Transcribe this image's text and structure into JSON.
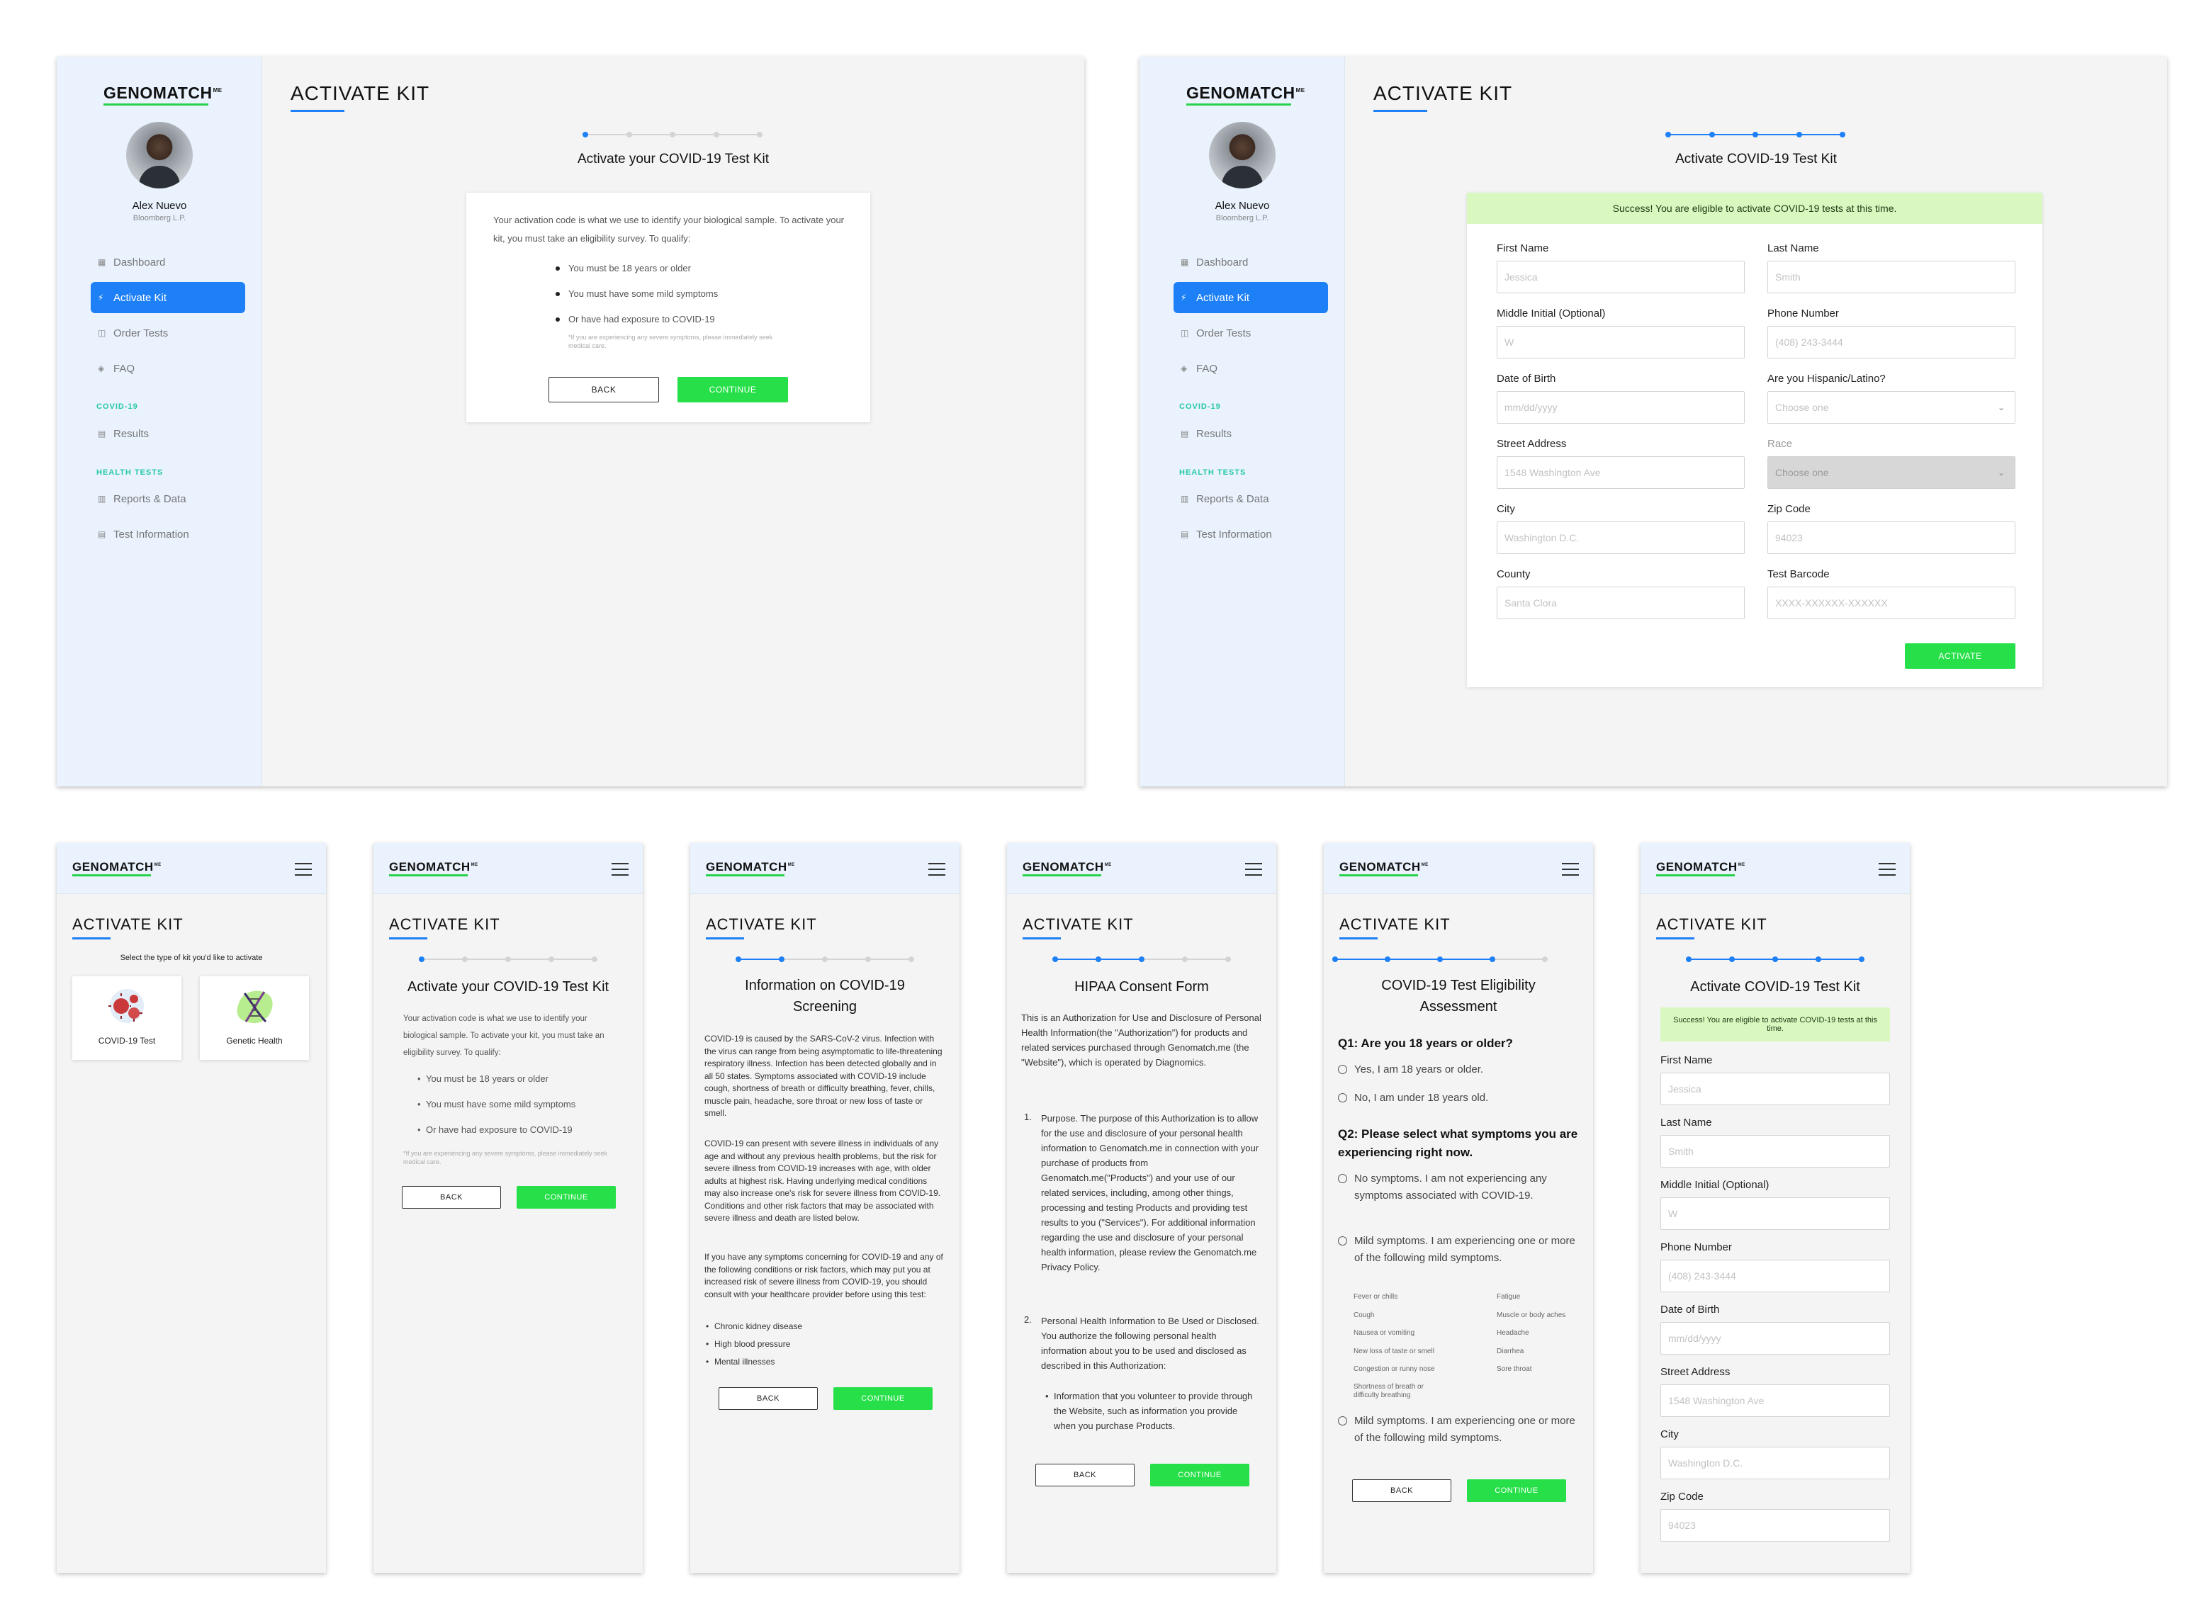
{
  "common": {
    "logo": "GENOMATCH",
    "logo_sup": "ME",
    "page_title": "ACTIVATE KIT",
    "back": "BACK",
    "continue": "CONTINUE"
  },
  "user": {
    "name": "Alex Nuevo",
    "company": "Bloomberg L.P."
  },
  "sidebar": {
    "items": [
      {
        "label": "Dashboard",
        "icon": "dashboard-icon",
        "glyph": "▦"
      },
      {
        "label": "Activate Kit",
        "icon": "lightning-icon",
        "glyph": "⚡"
      },
      {
        "label": "Order Tests",
        "icon": "bag-icon",
        "glyph": "◫"
      },
      {
        "label": "FAQ",
        "icon": "tag-icon",
        "glyph": "◈"
      }
    ],
    "section_covid": "COVID-19",
    "results": "Results",
    "section_health": "HEALTH TESTS",
    "reports": "Reports & Data",
    "test_info": "Test Information"
  },
  "colors": {
    "accent": "#1e80f6",
    "green": "#27e049",
    "sidebar": "#e9f2fd",
    "section": "#27c9a7",
    "success": "#d8f8c0"
  },
  "intro": {
    "heading": "Activate your COVID-19 Test Kit",
    "text": "Your activation code is what we use to identify your biological sample. To activate your kit, you must take an eligibility survey. To qualify:",
    "bullets": [
      "You must be 18 years or older",
      "You must have some mild symptoms",
      "Or have had exposure to COVID-19"
    ],
    "note": "*If you are experiencing any severe symptoms, please immediately seek medical care."
  },
  "form": {
    "heading": "Activate COVID-19 Test Kit",
    "success": "Success! You are eligible to activate COVID-19 tests at this time.",
    "activate": "ACTIVATE",
    "first_name": {
      "label": "First Name",
      "placeholder": "Jessica"
    },
    "last_name": {
      "label": "Last Name",
      "placeholder": "Smith"
    },
    "middle": {
      "label": "Middle Initial (Optional)",
      "placeholder": "W"
    },
    "phone": {
      "label": "Phone Number",
      "placeholder": "(408) 243-3444"
    },
    "dob": {
      "label": "Date of Birth",
      "placeholder": "mm/dd/yyyy"
    },
    "hispanic": {
      "label": "Are you Hispanic/Latino?",
      "placeholder": "Choose one"
    },
    "street": {
      "label": "Street Address",
      "placeholder": "1548 Washington Ave"
    },
    "race": {
      "label": "Race",
      "placeholder": "Choose one"
    },
    "city": {
      "label": "City",
      "placeholder": "Washington D.C."
    },
    "zip": {
      "label": "Zip Code",
      "placeholder": "94023"
    },
    "county": {
      "label": "County",
      "placeholder": "Santa Clora"
    },
    "barcode": {
      "label": "Test Barcode",
      "placeholder": "XXXX-XXXXXX-XXXXXX"
    }
  },
  "select_kit": {
    "prompt": "Select the type of kit you'd like to activate",
    "covid": "COVID-19 Test",
    "genetic": "Genetic Health"
  },
  "info": {
    "heading": "Information on COVID-19 Screening",
    "p1": "COVID-19 is caused by the SARS-CoV-2 virus. Infection with the virus can range from being asymptomatic to life-threatening respiratory illness. Infection has been detected globally and in all 50 states. Symptoms associated with COVID-19 include cough, shortness of breath or difficulty breathing, fever, chills, muscle pain, headache, sore throat or new loss of taste or smell.",
    "p2": "COVID-19 can present with severe illness in individuals of any age and without any previous health problems, but the risk for severe illness from COVID-19 increases with age, with older adults at highest risk. Having underlying medical conditions may also increase one's risk for severe illness from COVID-19. Conditions and other risk factors that may be associated with severe illness and death are listed below.",
    "p3": "If you have any symptoms concerning for COVID-19 and any of the following conditions or risk factors, which may put you at increased risk of severe illness from COVID-19, you should consult with your healthcare provider before using this test:",
    "bullets": [
      "Chronic kidney disease",
      "High blood pressure",
      "Mental illnesses"
    ]
  },
  "hipaa": {
    "heading": "HIPAA Consent Form",
    "intro": "This is an Authorization for Use and Disclosure of Personal Health Information(the \"Authorization\") for products and related services purchased through Genomatch.me (the \"Website\"), which is operated by Diagnomics.",
    "item1": "Purpose. The purpose of this Authorization is to allow for the use and disclosure of your personal health information to Genomatch.me in connection with your purchase of products from Genomatch.me(\"Products\") and your use of our related services, including, among other things, processing and testing Products and providing test results to you (\"Services\"). For additional information regarding the use and disclosure of your personal health information, please review the Genomatch.me Privacy Policy.",
    "item2": "Personal Health Information to Be Used or Disclosed. You authorize the following personal health information about you to be used and disclosed as described in this Authorization:",
    "sub": "Information that you volunteer to provide through the Website, such as information you provide when you purchase Products."
  },
  "eligibility": {
    "heading": "COVID-19 Test Eligibility Assessment",
    "q1": "Q1: Are you 18 years or older?",
    "q1_yes": "Yes, I am 18 years or older.",
    "q1_no": "No, I am under 18 years old.",
    "q2": "Q2: Please select what symptoms you are experiencing right now.",
    "opt1": "No symptoms. I am not experiencing any symptoms associated with COVID-19.",
    "opt2": "Mild symptoms. I am experiencing one or more of the following mild symptoms.",
    "symptoms_left": [
      "Fever or chills",
      "Cough",
      "Nausea or vomiting",
      "New loss of taste or smell",
      "Congestion or runny nose",
      "Shortness of breath or difficulty breathing"
    ],
    "symptoms_right": [
      "Fatigue",
      "Muscle or body aches",
      "Headache",
      "Diarrhea",
      "Sore throat"
    ],
    "opt3": "Mild symptoms. I am experiencing one or more of the following mild symptoms."
  },
  "mobile_form_success": "Success! You are eligible to activate COVID-19 tests at this time."
}
